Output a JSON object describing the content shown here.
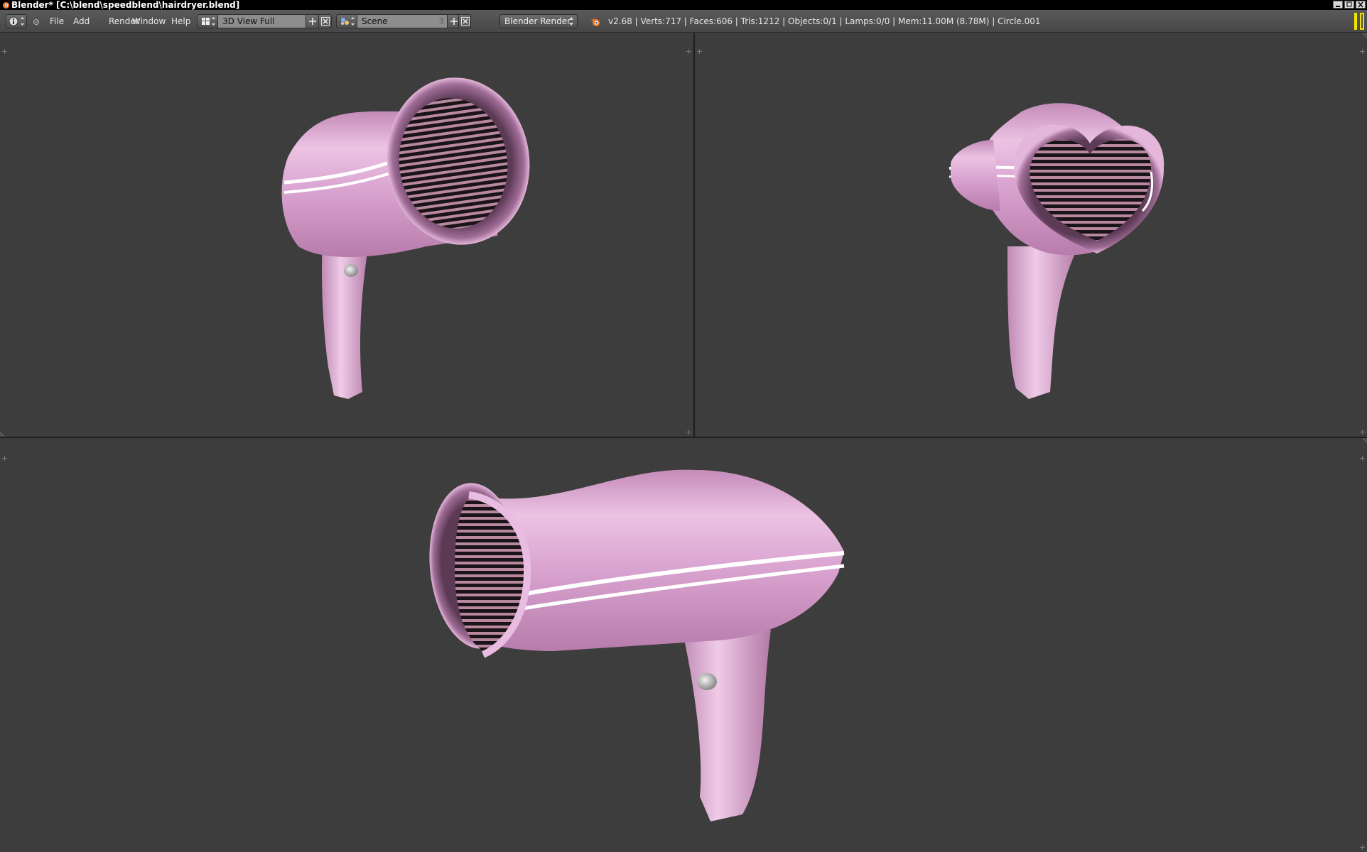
{
  "window": {
    "title": "Blender* [C:\\blend\\speedblend\\hairdryer.blend]"
  },
  "header": {
    "menus": [
      "File",
      "Add",
      "Render",
      "Window",
      "Help"
    ],
    "screen_layout": "3D View Full",
    "scene": "Scene",
    "scene_users": "3",
    "render_engine": "Blender Render",
    "stats": "v2.68 | Verts:717 | Faces:606 | Tris:1212 | Objects:0/1 | Lamps:0/0 | Mem:11.00M (8.78M) | Circle.001"
  },
  "icons": {
    "editor_type": "info-icon",
    "screen": "screen-layout-icon",
    "scene": "scene-icon",
    "add": "plus-icon",
    "remove": "x-icon",
    "logo": "blender-logo-icon"
  },
  "colors": {
    "viewport_bg": "#3d3d3d",
    "header_bg": "#4f4f4f",
    "dryer_pink": "#d9a3d0",
    "area_handle": "#f2e200"
  },
  "viewports": [
    {
      "name": "3d-viewport-top-left",
      "view": "hairdryer front-left perspective"
    },
    {
      "name": "3d-viewport-top-right",
      "view": "hairdryer heart nozzle perspective"
    },
    {
      "name": "3d-viewport-bottom",
      "view": "hairdryer side perspective"
    }
  ]
}
